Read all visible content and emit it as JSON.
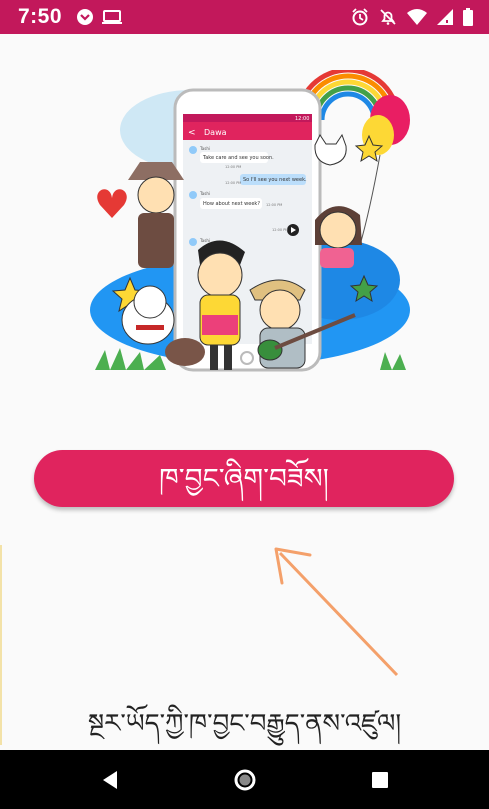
{
  "status_bar": {
    "time": "7:50",
    "left_icons": [
      "hangouts-icon",
      "cast-icon"
    ],
    "right_icons": [
      "alarm-icon",
      "notifications-off-icon",
      "wifi-icon",
      "signal-icon",
      "battery-icon"
    ],
    "color": "#c2185b"
  },
  "illustration": {
    "chat_title": "Dawa",
    "chat_time": "12:00",
    "messages": [
      {
        "sender": "Tashi",
        "text": "Take care and see you soon.",
        "time": "12:00 PM",
        "incoming": true
      },
      {
        "sender": "",
        "text": "So I'll see you next week.",
        "time": "12:00 PM",
        "incoming": false
      },
      {
        "sender": "Tashi",
        "text": "How about next week?",
        "time": "12:00 PM",
        "incoming": true
      },
      {
        "sender": "",
        "text": "",
        "time": "12:00 PM",
        "incoming": false
      },
      {
        "sender": "Tashi",
        "text": "",
        "time": "12:00 PM",
        "incoming": true
      }
    ]
  },
  "main": {
    "login_button_label": "ཁ་བྱང་ཞིག་བཟོས།",
    "existing_account_link": "སྔར་ཡོད་ཀྱི་ཁ་བྱང་བརྒྱུད་ནས་འཛུལ།",
    "accent_color": "#e0245e",
    "arrow_color": "#f4a06a"
  },
  "nav_bar": {
    "buttons": [
      "back-icon",
      "home-icon",
      "recents-icon"
    ]
  }
}
